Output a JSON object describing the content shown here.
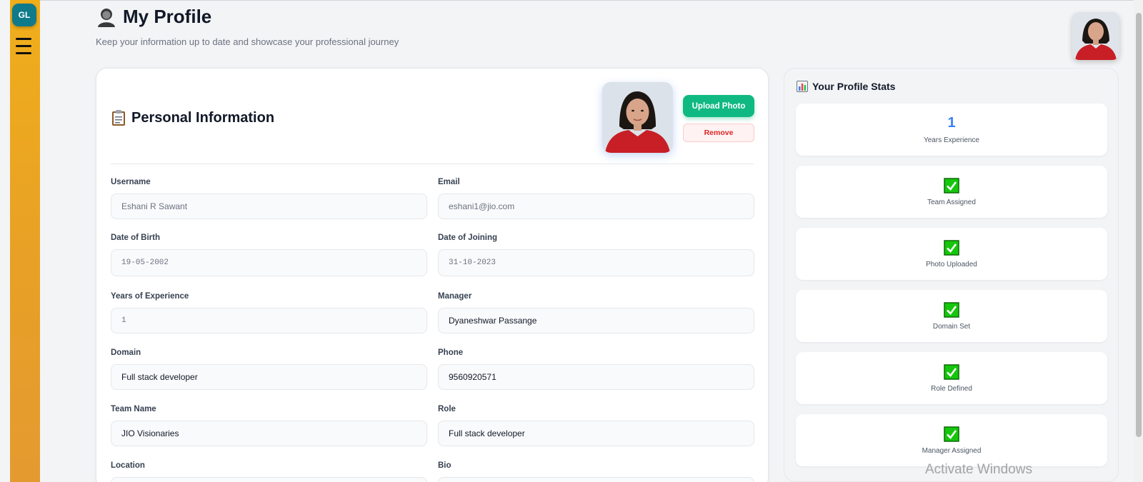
{
  "sidebar": {
    "logo_text": "GL",
    "menu_icon": "hamburger-menu-icon",
    "accent": "#f0ae1b"
  },
  "header": {
    "title": "My Profile",
    "subtitle": "Keep your information up to date and showcase your professional journey",
    "title_icon": "person-silhouette-icon"
  },
  "personal": {
    "title": "Personal Information",
    "title_icon": "clipboard-icon",
    "upload_label": "Upload Photo",
    "remove_label": "Remove",
    "fields": {
      "username": {
        "label": "Username",
        "value": "Eshani R Sawant"
      },
      "email": {
        "label": "Email",
        "value": "eshani1@jio.com"
      },
      "dob": {
        "label": "Date of Birth",
        "value": "19-05-2002"
      },
      "doj": {
        "label": "Date of Joining",
        "value": "31-10-2023"
      },
      "experience": {
        "label": "Years of Experience",
        "value": "1"
      },
      "manager": {
        "label": "Manager",
        "value": "Dyaneshwar Passange"
      },
      "domain": {
        "label": "Domain",
        "value": "Full stack developer"
      },
      "phone": {
        "label": "Phone",
        "value": "9560920571"
      },
      "team": {
        "label": "Team Name",
        "value": "JIO Visionaries"
      },
      "role": {
        "label": "Role",
        "value": "Full stack developer"
      },
      "location": {
        "label": "Location"
      },
      "bio": {
        "label": "Bio"
      }
    }
  },
  "stats": {
    "title": "Your Profile Stats",
    "title_icon": "bar-chart-icon",
    "cards": [
      {
        "value": "1",
        "label": "Years Experience"
      },
      {
        "label": "Team Assigned",
        "icon": "check-mark-icon"
      },
      {
        "label": "Photo Uploaded",
        "icon": "check-mark-icon"
      },
      {
        "label": "Domain Set",
        "icon": "check-mark-icon"
      },
      {
        "label": "Role Defined",
        "icon": "check-mark-icon"
      },
      {
        "label": "Manager Assigned",
        "icon": "check-mark-icon"
      }
    ]
  },
  "os": {
    "watermark": "Activate Windows"
  },
  "colors": {
    "primary_blue": "#3b82f6",
    "success_green": "#10b981",
    "danger_red": "#dc2626"
  }
}
